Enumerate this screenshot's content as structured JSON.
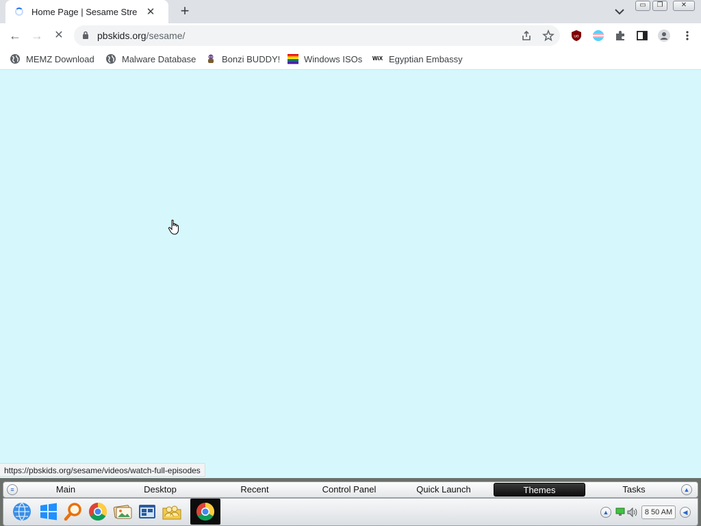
{
  "browser": {
    "tab_title": "Home Page | Sesame Street | PBS KIDS",
    "tab_close": "✕",
    "new_tab": "+",
    "window_controls": {
      "minimize": "▭",
      "restore": "❐",
      "close": "✕"
    }
  },
  "toolbar": {
    "back": "←",
    "forward": "→",
    "reload": "✕",
    "url_host": "pbskids.org",
    "url_path": "/sesame/"
  },
  "bookmarks": [
    {
      "label": "MEMZ Download",
      "icon": "globe-icon"
    },
    {
      "label": "Malware Database",
      "icon": "globe-icon"
    },
    {
      "label": "Bonzi BUDDY!",
      "icon": "bonzi-icon"
    },
    {
      "label": "Windows ISOs",
      "icon": "rainbow-flag-icon"
    },
    {
      "label": "Egyptian Embassy",
      "icon": "wix-icon",
      "icon_text": "WiX"
    }
  ],
  "page": {
    "background_color": "#d6f8fd",
    "status_url": "https://pbskids.org/sesame/videos/watch-full-episodes"
  },
  "desktop_menu": {
    "items": [
      "Main",
      "Desktop",
      "Recent",
      "Control Panel",
      "Quick Launch",
      "Themes",
      "Tasks"
    ],
    "active": "Themes"
  },
  "taskbar": {
    "apps": [
      "globe-icon",
      "windows-icon",
      "search-icon",
      "chrome-icon",
      "photos-icon",
      "explorer-icon",
      "folder-people-icon"
    ],
    "running": "chrome-icon",
    "clock": "8 50 AM"
  }
}
